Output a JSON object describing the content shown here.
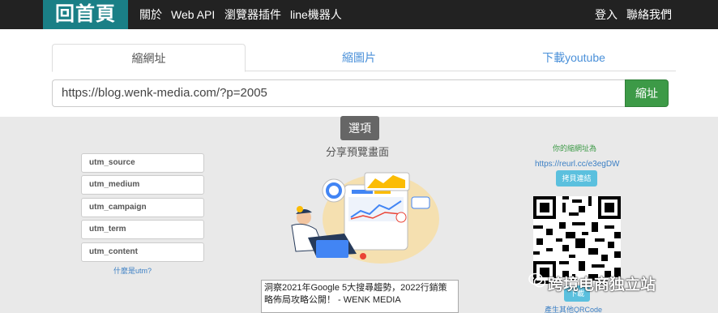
{
  "navbar": {
    "brand": "回首頁",
    "links": [
      "關於",
      "Web API",
      "瀏覽器插件",
      "line機器人"
    ],
    "right_links": [
      "登入",
      "聯絡我們"
    ]
  },
  "tabs": [
    "縮網址",
    "縮圖片",
    "下載youtube"
  ],
  "url_input": {
    "value": "https://blog.wenk-media.com/?p=2005"
  },
  "shorten_button": "縮址",
  "options_button": "選項",
  "utm": {
    "fields": [
      "utm_source",
      "utm_medium",
      "utm_campaign",
      "utm_term",
      "utm_content"
    ],
    "help_link": "什麼是utm?"
  },
  "preview": {
    "title": "分享預覽畫面",
    "og_description": "洞察2021年Google 5大搜尋趨勢，2022行銷策略佈局攻略公開！ - WENK MEDIA"
  },
  "result": {
    "label": "你的縮網址為",
    "short_url": "https://reurl.cc/e3egDW",
    "copy_button": "拷貝連結",
    "download_button": "下載",
    "other_qr_link": "產生其他QRCode"
  },
  "watermark": "跨境电商独立站",
  "colors": {
    "brand": "#1a7f86",
    "navbar": "#222222",
    "success": "#3d9a47",
    "info": "#5bc0de",
    "link": "#3b7fc4"
  }
}
